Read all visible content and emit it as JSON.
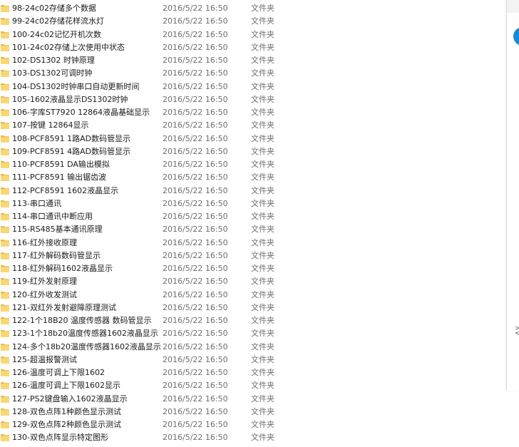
{
  "columns": {
    "folder_icon": "folder-icon",
    "folder_color": "#f8d775",
    "folder_tab_color": "#e8b84a"
  },
  "files": [
    {
      "name": "98-24c02存储多个数据",
      "date": "2016/5/22 16:50",
      "type": "文件夹"
    },
    {
      "name": "99-24c02存储花样流水灯",
      "date": "2016/5/22 16:50",
      "type": "文件夹"
    },
    {
      "name": "100-24c02记忆开机次数",
      "date": "2016/5/22 16:50",
      "type": "文件夹"
    },
    {
      "name": "101-24c02存储上次使用中状态",
      "date": "2016/5/22 16:50",
      "type": "文件夹"
    },
    {
      "name": "102-DS1302 时钟原理",
      "date": "2016/5/22 16:50",
      "type": "文件夹"
    },
    {
      "name": "103-DS1302可调时钟",
      "date": "2016/5/22 16:50",
      "type": "文件夹"
    },
    {
      "name": "104-DS1302时钟串口自动更新时间",
      "date": "2016/5/22 16:50",
      "type": "文件夹"
    },
    {
      "name": "105-1602液晶显示DS1302时钟",
      "date": "2016/5/22 16:50",
      "type": "文件夹"
    },
    {
      "name": "106-字库ST7920 12864液晶基础显示",
      "date": "2016/5/22 16:50",
      "type": "文件夹"
    },
    {
      "name": "107-按键 12864显示",
      "date": "2016/5/22 16:50",
      "type": "文件夹"
    },
    {
      "name": "108-PCF8591 1路AD数码管显示",
      "date": "2016/5/22 16:50",
      "type": "文件夹"
    },
    {
      "name": "109-PCF8591 4路AD数码管显示",
      "date": "2016/5/22 16:50",
      "type": "文件夹"
    },
    {
      "name": "110-PCF8591 DA输出模拟",
      "date": "2016/5/22 16:50",
      "type": "文件夹"
    },
    {
      "name": "111-PCF8591 输出锯齿波",
      "date": "2016/5/22 16:50",
      "type": "文件夹"
    },
    {
      "name": "112-PCF8591 1602液晶显示",
      "date": "2016/5/22 16:50",
      "type": "文件夹"
    },
    {
      "name": "113-串口通讯",
      "date": "2016/5/22 16:50",
      "type": "文件夹"
    },
    {
      "name": "114-串口通讯中断应用",
      "date": "2016/5/22 16:50",
      "type": "文件夹"
    },
    {
      "name": "115-RS485基本通讯原理",
      "date": "2016/5/22 16:50",
      "type": "文件夹"
    },
    {
      "name": "116-红外接收原理",
      "date": "2016/5/22 16:50",
      "type": "文件夹"
    },
    {
      "name": "117-红外解码数码管显示",
      "date": "2016/5/22 16:50",
      "type": "文件夹"
    },
    {
      "name": "118-红外解码1602液晶显示",
      "date": "2016/5/22 16:50",
      "type": "文件夹"
    },
    {
      "name": "119-红外发射原理",
      "date": "2016/5/22 16:50",
      "type": "文件夹"
    },
    {
      "name": "120-红外收发测试",
      "date": "2016/5/22 16:50",
      "type": "文件夹"
    },
    {
      "name": "121-双红外发射避障原理测试",
      "date": "2016/5/22 16:50",
      "type": "文件夹"
    },
    {
      "name": "122-1个18B20 温度传感器 数码管显示",
      "date": "2016/5/22 16:50",
      "type": "文件夹"
    },
    {
      "name": "123-1个18b20温度传感器1602液晶显示",
      "date": "2016/5/22 16:50",
      "type": "文件夹"
    },
    {
      "name": "124-多个18b20温度传感器1602液晶显示",
      "date": "2016/5/22 16:50",
      "type": "文件夹"
    },
    {
      "name": "125-超温报警测试",
      "date": "2016/5/22 16:50",
      "type": "文件夹"
    },
    {
      "name": "126-温度可调上下限1602",
      "date": "2016/5/22 16:50",
      "type": "文件夹"
    },
    {
      "name": "126-温度可调上下限1602显示",
      "date": "2016/5/22 16:50",
      "type": "文件夹"
    },
    {
      "name": "127-PS2键盘输入1602液晶显示",
      "date": "2016/5/22 16:50",
      "type": "文件夹"
    },
    {
      "name": "128-双色点阵1种颜色显示测试",
      "date": "2016/5/22 16:50",
      "type": "文件夹"
    },
    {
      "name": "129-双色点阵2种颜色显示测试",
      "date": "2016/5/22 16:50",
      "type": "文件夹"
    },
    {
      "name": "130-双色点阵显示特定图形",
      "date": "2016/5/22 16:50",
      "type": "文件夹"
    }
  ],
  "side_panel": {
    "icon": "info-circle-icon",
    "icon_color": "#1a8ad4",
    "expand_icon": "expand-icon"
  }
}
